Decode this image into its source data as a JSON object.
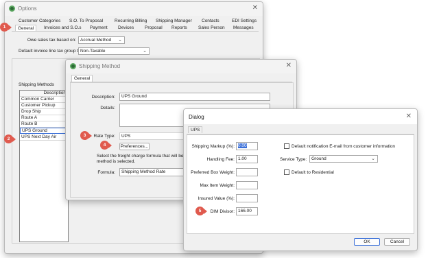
{
  "options_window": {
    "title": "Options",
    "tabs_row1": [
      "Customer Categories",
      "S.O. To Proposal",
      "Recurring Billing",
      "Shipping Manager",
      "Contacts",
      "EDI Settings"
    ],
    "tabs_row2": [
      "General",
      "Invoices and S.O.s",
      "Payment",
      "Devices",
      "Proposal",
      "Reports",
      "Sales Person",
      "Messages"
    ],
    "owe_sales_tax_label": "Owe sales tax based on:",
    "owe_sales_tax_value": "Accrual Method",
    "default_tax_group_label": "Default invoice line tax group to:",
    "default_tax_group_value": "Non-Taxable",
    "shipping_methods_label": "Shipping Methods",
    "list_header": "Description",
    "methods": [
      "Common Carrier",
      "Customer Pickup",
      "Drop Ship",
      "Route A",
      "Route B",
      "UPS Ground",
      "UPS Next Day Air"
    ]
  },
  "shipping_method_window": {
    "title": "Shipping Method",
    "tab": "General",
    "description_label": "Description:",
    "description_value": "UPS Ground",
    "details_label": "Details:",
    "rate_type_label": "Rate Type:",
    "rate_type_value": "UPS",
    "preferences_button": "Preferences...",
    "help_text_line1": "Select the freight charge formula that will be used",
    "help_text_line2": "method is selected.",
    "formula_label": "Formula:",
    "formula_value": "Shipping Method Rate"
  },
  "dialog": {
    "title": "Dialog",
    "tab": "UPS",
    "shipping_markup_label": "Shipping Markup (%):",
    "shipping_markup_value": "0.00",
    "handling_fee_label": "Handling Fee:",
    "handling_fee_value": "1.00",
    "preferred_box_weight_label": "Preferred Box Weight:",
    "preferred_box_weight_value": "",
    "max_item_weight_label": "Max Item Weight:",
    "max_item_weight_value": "",
    "insured_value_label": "Insured Value (%):",
    "insured_value_value": "",
    "dim_divisor_label": "DIM Divisor:",
    "dim_divisor_value": "166.00",
    "default_notification_label": "Default notification E-mail from customer information",
    "service_type_label": "Service Type:",
    "service_type_value": "Ground",
    "default_residential_label": "Default to Residential",
    "ok_button": "OK",
    "cancel_button": "Cancel"
  },
  "callouts": [
    "1",
    "2",
    "3",
    "4",
    "5"
  ],
  "colors": {
    "callout": "#e05a4e",
    "selection_border": "#3a6fd8",
    "app_icon": "#2d6a36"
  }
}
